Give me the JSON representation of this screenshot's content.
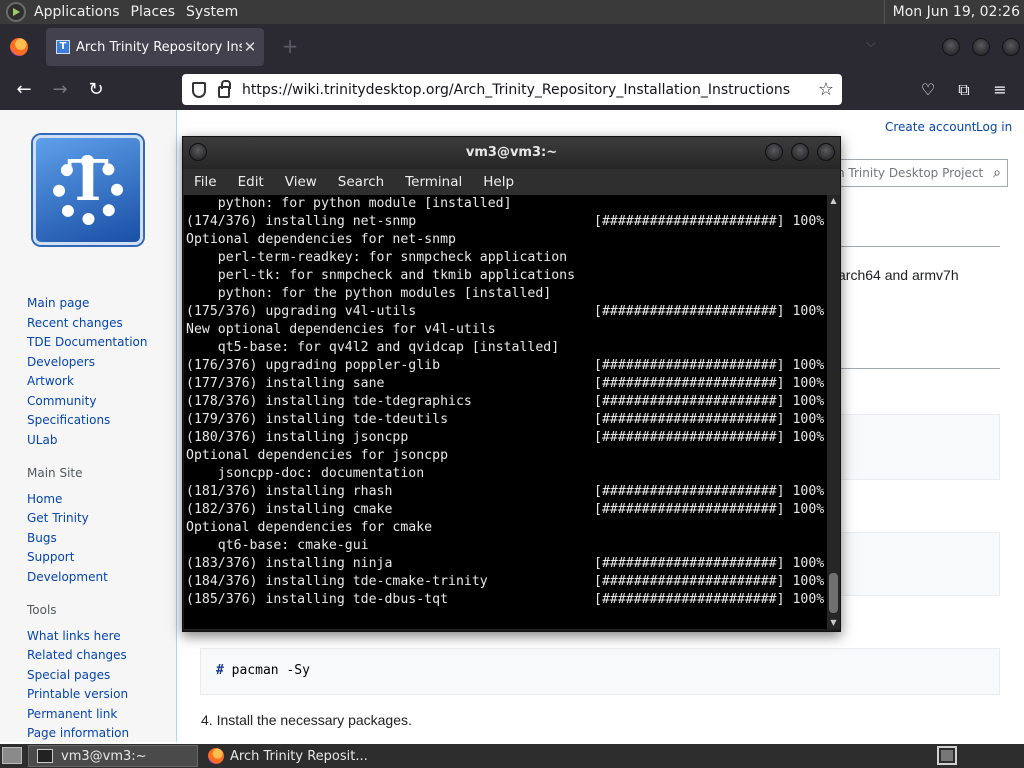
{
  "top_panel": {
    "menus": [
      "Applications",
      "Places",
      "System"
    ],
    "clock": "Mon Jun 19, 02:26"
  },
  "browser": {
    "tab_title": "Arch Trinity Repository Insta",
    "tab_favicon_text": "T",
    "tab_close": "✕",
    "new_tab": "+",
    "list_all_tabs": "⌵",
    "url": "https://wiki.trinitydesktop.org/Arch_Trinity_Repository_Installation_Instructions",
    "icons": {
      "back": "←",
      "forward": "→",
      "reload": "↻",
      "bookmark_star": "☆",
      "pocket": "♡",
      "extensions": "⧉",
      "app_menu": "≡"
    }
  },
  "wiki": {
    "personal": {
      "create_account": "Create account",
      "log_in": "Log in"
    },
    "search_placeholder": "h Trinity Desktop Project",
    "search_icon": "⌕",
    "arch_text": "arch64 and armv7h",
    "nav": {
      "main_links": [
        "Main page",
        "Recent changes",
        "TDE Documentation",
        "Developers",
        "Artwork",
        "Community",
        "Specifications",
        "ULab"
      ],
      "main_site_heading": "Main Site",
      "main_site_links": [
        "Home",
        "Get Trinity",
        "Bugs",
        "Support",
        "Development"
      ],
      "tools_heading": "Tools",
      "tools_links": [
        "What links here",
        "Related changes",
        "Special pages",
        "Printable version",
        "Permanent link",
        "Page information"
      ]
    },
    "code_command": {
      "prompt": "#",
      "command": "pacman -Sy"
    },
    "step_text": "4. Install the necessary packages."
  },
  "terminal": {
    "title": "vm3@vm3:~",
    "menu": [
      "File",
      "Edit",
      "View",
      "Search",
      "Terminal",
      "Help"
    ],
    "scroll_up": "▲",
    "scroll_down": "▼",
    "lines": [
      {
        "text": "    python: for python module [installed]",
        "progress": ""
      },
      {
        "text": "(174/376) installing net-snmp",
        "progress": "[######################] 100%"
      },
      {
        "text": "Optional dependencies for net-snmp",
        "progress": ""
      },
      {
        "text": "    perl-term-readkey: for snmpcheck application",
        "progress": ""
      },
      {
        "text": "    perl-tk: for snmpcheck and tkmib applications",
        "progress": ""
      },
      {
        "text": "    python: for the python modules [installed]",
        "progress": ""
      },
      {
        "text": "(175/376) upgrading v4l-utils",
        "progress": "[######################] 100%"
      },
      {
        "text": "New optional dependencies for v4l-utils",
        "progress": ""
      },
      {
        "text": "    qt5-base: for qv4l2 and qvidcap [installed]",
        "progress": ""
      },
      {
        "text": "(176/376) upgrading poppler-glib",
        "progress": "[######################] 100%"
      },
      {
        "text": "(177/376) installing sane",
        "progress": "[######################] 100%"
      },
      {
        "text": "(178/376) installing tde-tdegraphics",
        "progress": "[######################] 100%"
      },
      {
        "text": "(179/376) installing tde-tdeutils",
        "progress": "[######################] 100%"
      },
      {
        "text": "(180/376) installing jsoncpp",
        "progress": "[######################] 100%"
      },
      {
        "text": "Optional dependencies for jsoncpp",
        "progress": ""
      },
      {
        "text": "    jsoncpp-doc: documentation",
        "progress": ""
      },
      {
        "text": "(181/376) installing rhash",
        "progress": "[######################] 100%"
      },
      {
        "text": "(182/376) installing cmake",
        "progress": "[######################] 100%"
      },
      {
        "text": "Optional dependencies for cmake",
        "progress": ""
      },
      {
        "text": "    qt6-base: cmake-gui",
        "progress": ""
      },
      {
        "text": "(183/376) installing ninja",
        "progress": "[######################] 100%"
      },
      {
        "text": "(184/376) installing tde-cmake-trinity",
        "progress": "[######################] 100%"
      },
      {
        "text": "(185/376) installing tde-dbus-tqt",
        "progress": "[######################] 100%"
      }
    ]
  },
  "taskbar": {
    "tasks": [
      "vm3@vm3:~",
      "Arch Trinity Reposit..."
    ]
  }
}
